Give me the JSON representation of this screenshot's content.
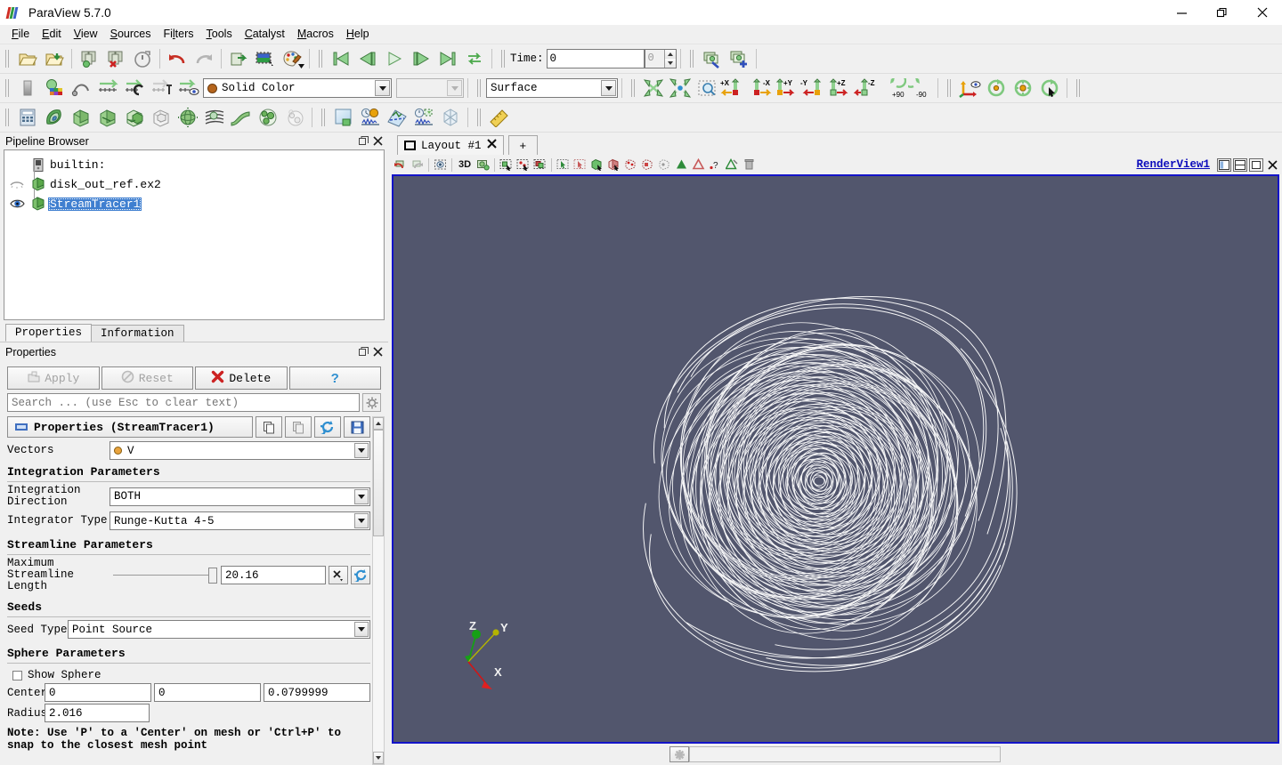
{
  "window": {
    "title": "ParaView 5.7.0",
    "logo_icon": "paraview-logo-icon",
    "minimize_icon": "minimize-icon",
    "restore_icon": "restore-icon",
    "close_icon": "close-icon"
  },
  "menubar": {
    "items": [
      {
        "label": "File",
        "mnemonic": "F"
      },
      {
        "label": "Edit",
        "mnemonic": "E"
      },
      {
        "label": "View",
        "mnemonic": "V"
      },
      {
        "label": "Sources",
        "mnemonic": "S"
      },
      {
        "label": "Filters",
        "mnemonic": "l"
      },
      {
        "label": "Tools",
        "mnemonic": "T"
      },
      {
        "label": "Catalyst",
        "mnemonic": "C"
      },
      {
        "label": "Macros",
        "mnemonic": "M"
      },
      {
        "label": "Help",
        "mnemonic": "H"
      }
    ]
  },
  "toolbar_row1": {
    "icons": [
      "open-file-icon",
      "open-recent-icon",
      "save-data-icon",
      "save-state-icon",
      "save-screenshot-icon",
      "undo-icon",
      "redo-icon",
      "connect-server-icon",
      "disconnect-server-icon",
      "color-palette-icon"
    ],
    "vcr": [
      "first-frame-icon",
      "previous-frame-icon",
      "play-icon",
      "next-frame-icon",
      "last-frame-icon",
      "loop-icon"
    ],
    "time_label": "Time:",
    "time_value": "0",
    "frame_index": "0",
    "camera_icons": [
      "adjust-camera-icon",
      "add-camera-link-icon"
    ]
  },
  "toolbar_row2": {
    "left_icons": [
      "edit-color-legend-icon",
      "rescale-to-data-range-icon",
      "rescale-to-custom-range-icon",
      "rescale-over-time-icon",
      "rescale-to-temporal-range-icon",
      "rescale-visible-range-icon",
      "toggle-color-legend-icon"
    ],
    "color_by": {
      "value": "Solid Color",
      "swatch_color": "#b5651d"
    },
    "color_array_component": {
      "value": "",
      "disabled": true
    },
    "representation": {
      "value": "Surface"
    },
    "camera_icons": [
      "reset-camera-icon",
      "zoom-to-data-icon",
      "zoom-to-box-icon",
      "plus-x-icon",
      "minus-x-icon",
      "plus-y-icon",
      "minus-y-icon",
      "plus-z-icon",
      "minus-z-icon",
      "rotate-plus-90-icon",
      "rotate-minus-90-icon"
    ],
    "rotate_labels": [
      "+X",
      "-X",
      "+Y",
      "-Y",
      "+Z",
      "-Z",
      "+90",
      "-90"
    ],
    "right_icons": [
      "show-center-axes-icon",
      "reset-center-icon",
      "pick-center-icon",
      "rotate-center-icon"
    ]
  },
  "toolbar_row3": {
    "filter_icons": [
      "calculator-icon",
      "contour-icon",
      "clip-icon",
      "slice-icon",
      "threshold-icon",
      "extract-subset-icon",
      "glyph-icon",
      "stream-tracer-icon",
      "warp-icon",
      "group-datasets-icon",
      "extract-level-icon"
    ],
    "view_icons": [
      "split-view-icon",
      "plot-over-time-icon",
      "plot-over-line-icon",
      "probe-location-icon",
      "slice-view-icon"
    ],
    "measure_icons": [
      "ruler-icon"
    ]
  },
  "pipeline_browser": {
    "title": "Pipeline Browser",
    "undock_icon": "undock-icon",
    "close_icon": "close-icon",
    "items": [
      {
        "label": "builtin:",
        "icon": "server-icon",
        "eye": "none",
        "indent": 1,
        "selected": false
      },
      {
        "label": "disk_out_ref.ex2",
        "icon": "dataset-icon",
        "eye": "hidden",
        "indent": 1,
        "selected": false
      },
      {
        "label": "StreamTracer1",
        "icon": "dataset-icon",
        "eye": "visible",
        "indent": 1,
        "selected": true
      }
    ]
  },
  "panel_tabs": [
    {
      "label": "Properties",
      "active": true
    },
    {
      "label": "Information",
      "active": false
    }
  ],
  "properties_panel": {
    "title": "Properties",
    "undock_icon": "undock-icon",
    "close_icon": "close-icon",
    "buttons": [
      {
        "label": "Apply",
        "icon": "apply-icon",
        "enabled": false
      },
      {
        "label": "Reset",
        "icon": "reset-icon",
        "enabled": false
      },
      {
        "label": "Delete",
        "icon": "delete-icon",
        "enabled": true
      },
      {
        "label": "?",
        "icon": "help-icon",
        "enabled": true
      }
    ],
    "search_placeholder": "Search ... (use Esc to clear text)",
    "gear_icon": "gear-icon",
    "section_header": {
      "title": "Properties (StreamTracer1)",
      "dash_icon": "dash-icon",
      "actions": [
        "copy-icon",
        "paste-icon",
        "restore-defaults-icon",
        "save-as-defaults-icon"
      ]
    },
    "fields": {
      "vectors": {
        "label": "Vectors",
        "value": "V",
        "swatch_color": "#e8a33d"
      },
      "integration_params_header": "Integration Parameters",
      "integration_direction": {
        "label": "Integration Direction",
        "value": "BOTH"
      },
      "integrator_type": {
        "label": "Integrator Type",
        "value": "Runge-Kutta 4-5"
      },
      "streamline_params_header": "Streamline Parameters",
      "max_streamline_length": {
        "label": "Maximum Streamline Length",
        "value": "20.16",
        "slider_pct": 100,
        "reset_icon": "restore-default-icon",
        "clear_icon": "x-icon"
      },
      "seeds_header": "Seeds",
      "seed_type": {
        "label": "Seed Type",
        "value": "Point Source"
      },
      "sphere_params_header": "Sphere Parameters",
      "show_sphere": {
        "label": "Show Sphere",
        "checked": false
      },
      "center": {
        "label": "Center",
        "values": [
          "0",
          "0",
          "0.0799999"
        ]
      },
      "radius": {
        "label": "Radius",
        "value": "2.016"
      },
      "note": "Note: Use 'P' to a 'Center' on mesh or 'Ctrl+P' to snap to the closest mesh point"
    }
  },
  "layout": {
    "tabs": [
      {
        "label": "Layout #1",
        "icon": "layout-icon",
        "close_icon": "close-icon",
        "active": true
      }
    ],
    "new_tab_label": "+"
  },
  "view_toolbar": {
    "icons": [
      "undo-camera-icon",
      "redo-camera-icon",
      "capture-screenshot-icon",
      "toggle-3d-label",
      "camera-mode-icon",
      "select-cells-icon",
      "select-points-icon",
      "select-cells-through-icon",
      "select-surface-points-icon",
      "select-frustum-points-icon",
      "select-blocks-icon",
      "interactive-select-cells-icon",
      "interactive-select-points-icon",
      "hover-cells-icon",
      "hover-points-icon",
      "plot-selection-icon",
      "extract-selection-icon",
      "find-data-icon",
      "clear-selection-icon",
      "trash-selection-icon"
    ],
    "mode_3d_label": "3D",
    "view_name": "RenderView1",
    "window_buttons": [
      "split-horizontal-icon",
      "split-vertical-icon",
      "maximize-icon",
      "close-view-icon"
    ]
  },
  "render_view": {
    "background_color": "#52566d",
    "border_color": "#1313c8",
    "streamline_color": "#ffffff",
    "orientation_axes": [
      {
        "label": "Z",
        "color": "#16a016"
      },
      {
        "label": "Y",
        "color": "#b4b400"
      },
      {
        "label": "X",
        "color": "#d41414"
      }
    ]
  },
  "status_bar": {
    "progress_icon": "busy-icon",
    "message": ""
  }
}
